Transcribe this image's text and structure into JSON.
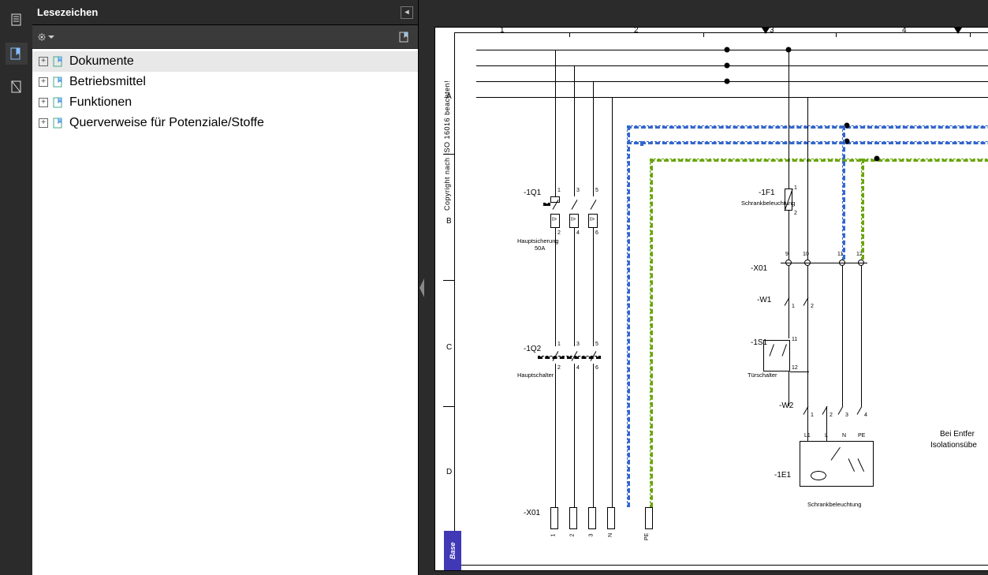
{
  "panel": {
    "title": "Lesezeichen",
    "tree": [
      {
        "label": "Dokumente",
        "selected": true
      },
      {
        "label": "Betriebsmittel",
        "selected": false
      },
      {
        "label": "Funktionen",
        "selected": false
      },
      {
        "label": "Querverweise für Potenziale/Stoffe",
        "selected": false
      }
    ]
  },
  "sheet": {
    "copyright_note": "Copyright nach ISO 16016 beachten!",
    "columns": [
      "1",
      "2",
      "3",
      "4"
    ],
    "rows": [
      "A",
      "B",
      "C",
      "D"
    ],
    "base_tag": "Base",
    "components": {
      "q1": {
        "tag": "-1Q1",
        "desc1": "Hauptsicherung",
        "desc2": "50A",
        "pins_top": [
          "1",
          "3",
          "5"
        ],
        "pins_bot": [
          "2",
          "4",
          "6"
        ]
      },
      "q2": {
        "tag": "-1Q2",
        "desc": "Hauptschalter",
        "pins_top": [
          "1",
          "3",
          "5"
        ],
        "pins_bot": [
          "2",
          "4",
          "6"
        ]
      },
      "f1": {
        "tag": "-1F1",
        "desc": "Schrankbeleuchtung",
        "pins": [
          "1",
          "2"
        ]
      },
      "x01a": {
        "tag": "-X01",
        "pins": [
          "1",
          "2",
          "3",
          "N",
          "PE"
        ]
      },
      "x01b": {
        "tag": "-X01",
        "pins": [
          "9",
          "10",
          "11",
          "12"
        ]
      },
      "w1": {
        "tag": "-W1",
        "cores": [
          "1",
          "2"
        ]
      },
      "s1": {
        "tag": "-1S1",
        "desc": "Türschalter",
        "pins": [
          "11",
          "12"
        ]
      },
      "w2": {
        "tag": "-W2",
        "cores": [
          "1",
          "2",
          "3",
          "4"
        ]
      },
      "e1": {
        "tag": "-1E1",
        "desc": "Schrankbeleuchtung",
        "terms": [
          "L1",
          "L",
          "N",
          "PE"
        ]
      }
    },
    "side_note": {
      "line1": "Bei Entfer",
      "line2": "Isolationsübe"
    }
  }
}
